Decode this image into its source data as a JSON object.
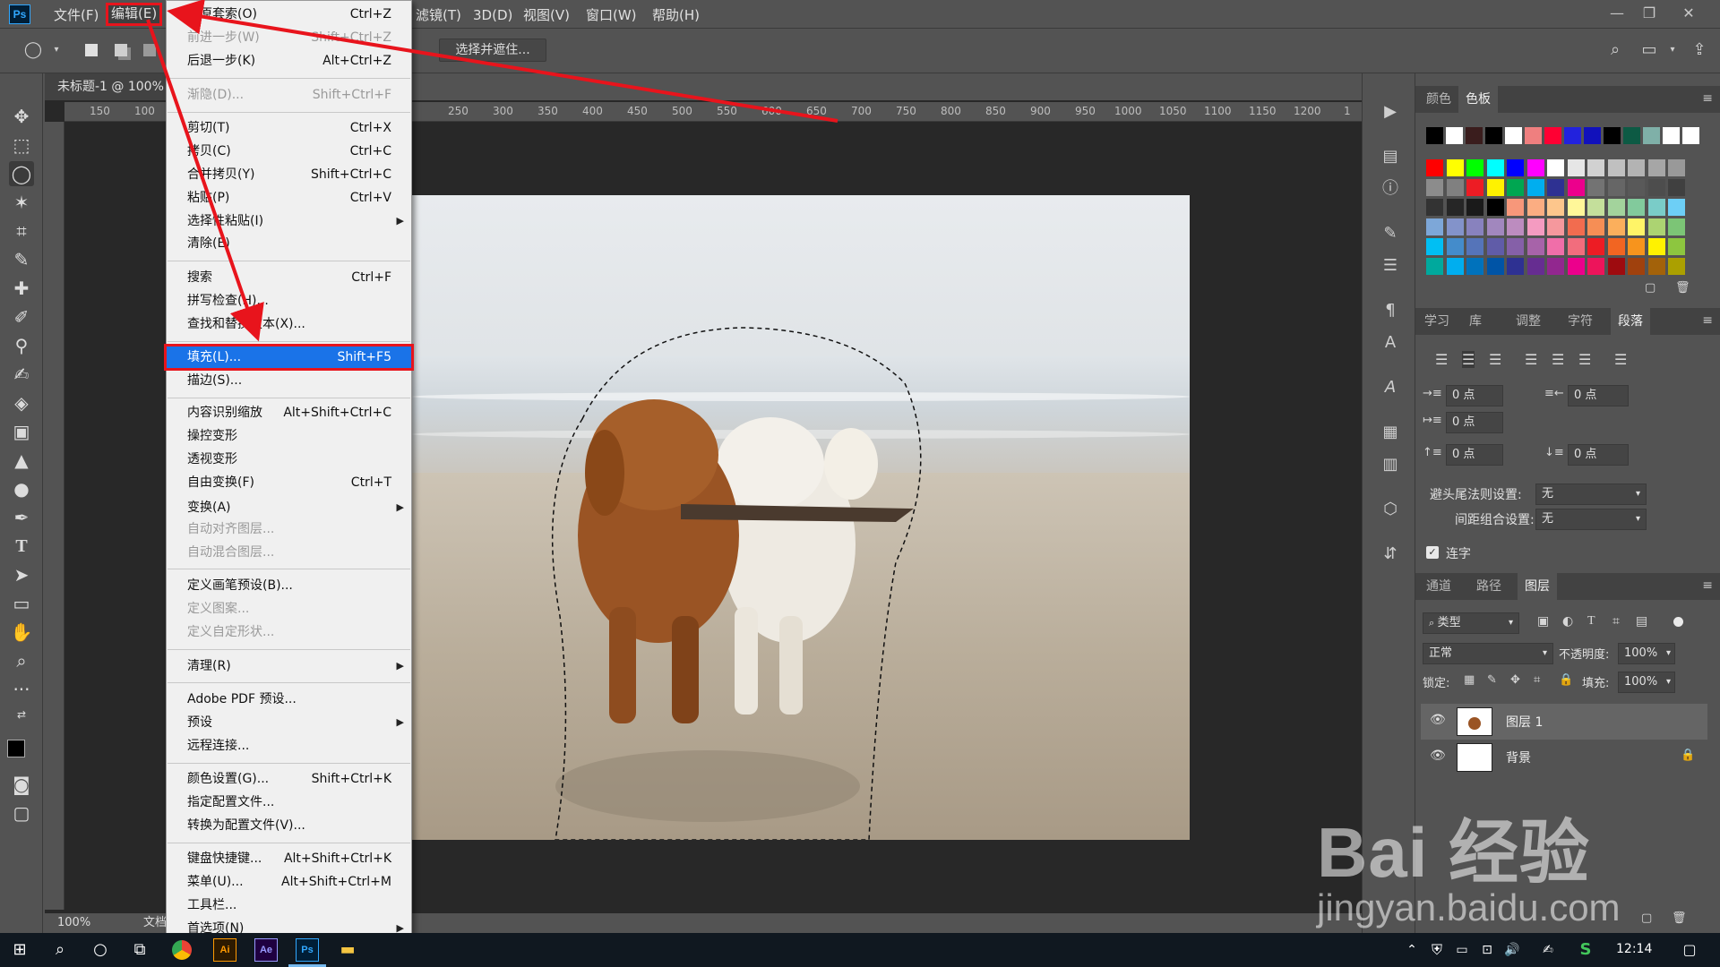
{
  "menubar": {
    "logo": "Ps",
    "items": [
      "文件(F)",
      "编辑(E)",
      "滤镜(T)",
      "3D(D)",
      "视图(V)",
      "窗口(W)",
      "帮助(H)"
    ],
    "active": "编辑(E)"
  },
  "optbar": {
    "select_mask_label": "选择并遮住..."
  },
  "document": {
    "tab_title": "未标题-1 @ 100%",
    "zoom": "100%",
    "status_doc": "文档"
  },
  "ruler": {
    "top": [
      "150",
      "100",
      "250",
      "300",
      "350",
      "400",
      "450",
      "500",
      "550",
      "600",
      "650",
      "700",
      "750",
      "800",
      "850",
      "900",
      "950",
      "1000",
      "1050",
      "1100",
      "1150",
      "1200",
      "1"
    ],
    "left": [
      "0",
      "5",
      "0",
      "5",
      "1",
      "0",
      "1",
      "5",
      "2",
      "0",
      "2",
      "5",
      "3",
      "0",
      "3",
      "5",
      "4",
      "0",
      "4",
      "5",
      "5",
      "0",
      "5",
      "5",
      "6",
      "0",
      "6",
      "5",
      "7",
      "0",
      "7",
      "5",
      "8"
    ]
  },
  "edit_menu": {
    "items": [
      {
        "label": "还原套索(O)",
        "shortcut": "Ctrl+Z",
        "disabled": false
      },
      {
        "label": "前进一步(W)",
        "shortcut": "Shift+Ctrl+Z",
        "disabled": true
      },
      {
        "label": "后退一步(K)",
        "shortcut": "Alt+Ctrl+Z",
        "disabled": false
      },
      {
        "label": "渐隐(D)...",
        "shortcut": "Shift+Ctrl+F",
        "disabled": true
      },
      {
        "label": "剪切(T)",
        "shortcut": "Ctrl+X",
        "disabled": false
      },
      {
        "label": "拷贝(C)",
        "shortcut": "Ctrl+C",
        "disabled": false
      },
      {
        "label": "合并拷贝(Y)",
        "shortcut": "Shift+Ctrl+C",
        "disabled": false
      },
      {
        "label": "粘贴(P)",
        "shortcut": "Ctrl+V",
        "disabled": false
      },
      {
        "label": "选择性粘贴(I)",
        "shortcut": "",
        "submenu": true,
        "disabled": false
      },
      {
        "label": "清除(E)",
        "shortcut": "",
        "disabled": false
      },
      {
        "label": "搜索",
        "shortcut": "Ctrl+F",
        "disabled": false
      },
      {
        "label": "拼写检查(H)...",
        "shortcut": "",
        "disabled": false
      },
      {
        "label": "查找和替换文本(X)...",
        "shortcut": "",
        "disabled": false
      },
      {
        "label": "填充(L)...",
        "shortcut": "Shift+F5",
        "disabled": false,
        "highlighted": true
      },
      {
        "label": "描边(S)...",
        "shortcut": "",
        "disabled": false
      },
      {
        "label": "内容识别缩放",
        "shortcut": "Alt+Shift+Ctrl+C",
        "disabled": false
      },
      {
        "label": "操控变形",
        "shortcut": "",
        "disabled": false
      },
      {
        "label": "透视变形",
        "shortcut": "",
        "disabled": false
      },
      {
        "label": "自由变换(F)",
        "shortcut": "Ctrl+T",
        "disabled": false
      },
      {
        "label": "变换(A)",
        "shortcut": "",
        "submenu": true,
        "disabled": false
      },
      {
        "label": "自动对齐图层...",
        "shortcut": "",
        "disabled": true
      },
      {
        "label": "自动混合图层...",
        "shortcut": "",
        "disabled": true
      },
      {
        "label": "定义画笔预设(B)...",
        "shortcut": "",
        "disabled": false
      },
      {
        "label": "定义图案...",
        "shortcut": "",
        "disabled": true
      },
      {
        "label": "定义自定形状...",
        "shortcut": "",
        "disabled": true
      },
      {
        "label": "清理(R)",
        "shortcut": "",
        "submenu": true,
        "disabled": false
      },
      {
        "label": "Adobe PDF 预设...",
        "shortcut": "",
        "disabled": false
      },
      {
        "label": "预设",
        "shortcut": "",
        "submenu": true,
        "disabled": false
      },
      {
        "label": "远程连接...",
        "shortcut": "",
        "disabled": false
      },
      {
        "label": "颜色设置(G)...",
        "shortcut": "Shift+Ctrl+K",
        "disabled": false
      },
      {
        "label": "指定配置文件...",
        "shortcut": "",
        "disabled": false
      },
      {
        "label": "转换为配置文件(V)...",
        "shortcut": "",
        "disabled": false
      },
      {
        "label": "键盘快捷键...",
        "shortcut": "Alt+Shift+Ctrl+K",
        "disabled": false
      },
      {
        "label": "菜单(U)...",
        "shortcut": "Alt+Shift+Ctrl+M",
        "disabled": false
      },
      {
        "label": "工具栏...",
        "shortcut": "",
        "disabled": false
      },
      {
        "label": "首选项(N)",
        "shortcut": "",
        "submenu": true,
        "disabled": false
      }
    ]
  },
  "swatch_panel": {
    "tabs": [
      "颜色",
      "色板"
    ],
    "active": "色板",
    "colors": {
      "row0": [
        "#000000",
        "#ffffff",
        "#3a1d1d",
        "#000000",
        "#ffffff",
        "#ef7f7f",
        "#ff0033",
        "#2222dd",
        "#1111bb",
        "#000000",
        "#0d5a44",
        "#7fb0a8",
        "#ffffff",
        "#ffffff"
      ],
      "grid": [
        [
          "#ff0000",
          "#ffff00",
          "#00ff00",
          "#00ffff",
          "#0000ff",
          "#ff00ff",
          "#ffffff",
          "#e6e6e6",
          "#d1d1d1",
          "#c0c0c0",
          "#b3b3b3",
          "#a6a6a6",
          "#999999"
        ],
        [
          "#8c8c8c",
          "#808080",
          "#ed1c24",
          "#fff200",
          "#00a651",
          "#00aeef",
          "#2e3192",
          "#ec008c",
          "#737373",
          "#666666",
          "#595959",
          "#4d4d4d",
          "#404040"
        ],
        [
          "#333333",
          "#262626",
          "#1a1a1a",
          "#000000",
          "#f7977a",
          "#fbad82",
          "#fdc68c",
          "#fff799",
          "#c4df9b",
          "#a3d39c",
          "#82ca9c",
          "#7accc8",
          "#6dcff6"
        ],
        [
          "#7da7d8",
          "#8393ca",
          "#8882be",
          "#a187be",
          "#bc8cbf",
          "#f49bc1",
          "#f5989d",
          "#f26c4f",
          "#f68e55",
          "#fbaf5c",
          "#fff467",
          "#acd372",
          "#7cc576"
        ],
        [
          "#00bff3",
          "#448ccb",
          "#5574b9",
          "#605ca8",
          "#8560a8",
          "#a763a9",
          "#f06ea9",
          "#f26d7d",
          "#ed1c24",
          "#f26522",
          "#f7941d",
          "#fff200",
          "#8dc63f"
        ],
        [
          "#00a99d",
          "#00aeef",
          "#0072bc",
          "#0054a6",
          "#2e3192",
          "#662d91",
          "#92278f",
          "#ec008c",
          "#ed145b",
          "#9e0b0f",
          "#a0410d",
          "#a3620a",
          "#aba000"
        ]
      ]
    }
  },
  "paragraph_panel": {
    "tabs": [
      "学习",
      "库",
      "调整",
      "字符",
      "段落"
    ],
    "active": "段落",
    "indent_left": "0 点",
    "indent_right": "0 点",
    "indent_first": "0 点",
    "space_before": "0 点",
    "space_after": "0 点",
    "hyphen_label": "避头尾法则设置:",
    "hyphen_value": "无",
    "spacing_label": "间距组合设置:",
    "spacing_value": "无",
    "ligature_label": "连字"
  },
  "layers_panel": {
    "tabs": [
      "通道",
      "路径",
      "图层"
    ],
    "active": "图层",
    "filter_label": "类型",
    "blend_mode": "正常",
    "opacity_label": "不透明度:",
    "opacity_value": "100%",
    "lock_label": "锁定:",
    "fill_label": "填充:",
    "fill_value": "100%",
    "layers": [
      {
        "name": "图层 1",
        "selected": true
      },
      {
        "name": "背景",
        "locked": true
      }
    ]
  },
  "taskbar": {
    "clock": "12:14",
    "apps": [
      "Ai",
      "Ae",
      "Ps"
    ]
  },
  "watermark": {
    "text": "Bai 经验",
    "url": "jingyan.baidu.com"
  }
}
